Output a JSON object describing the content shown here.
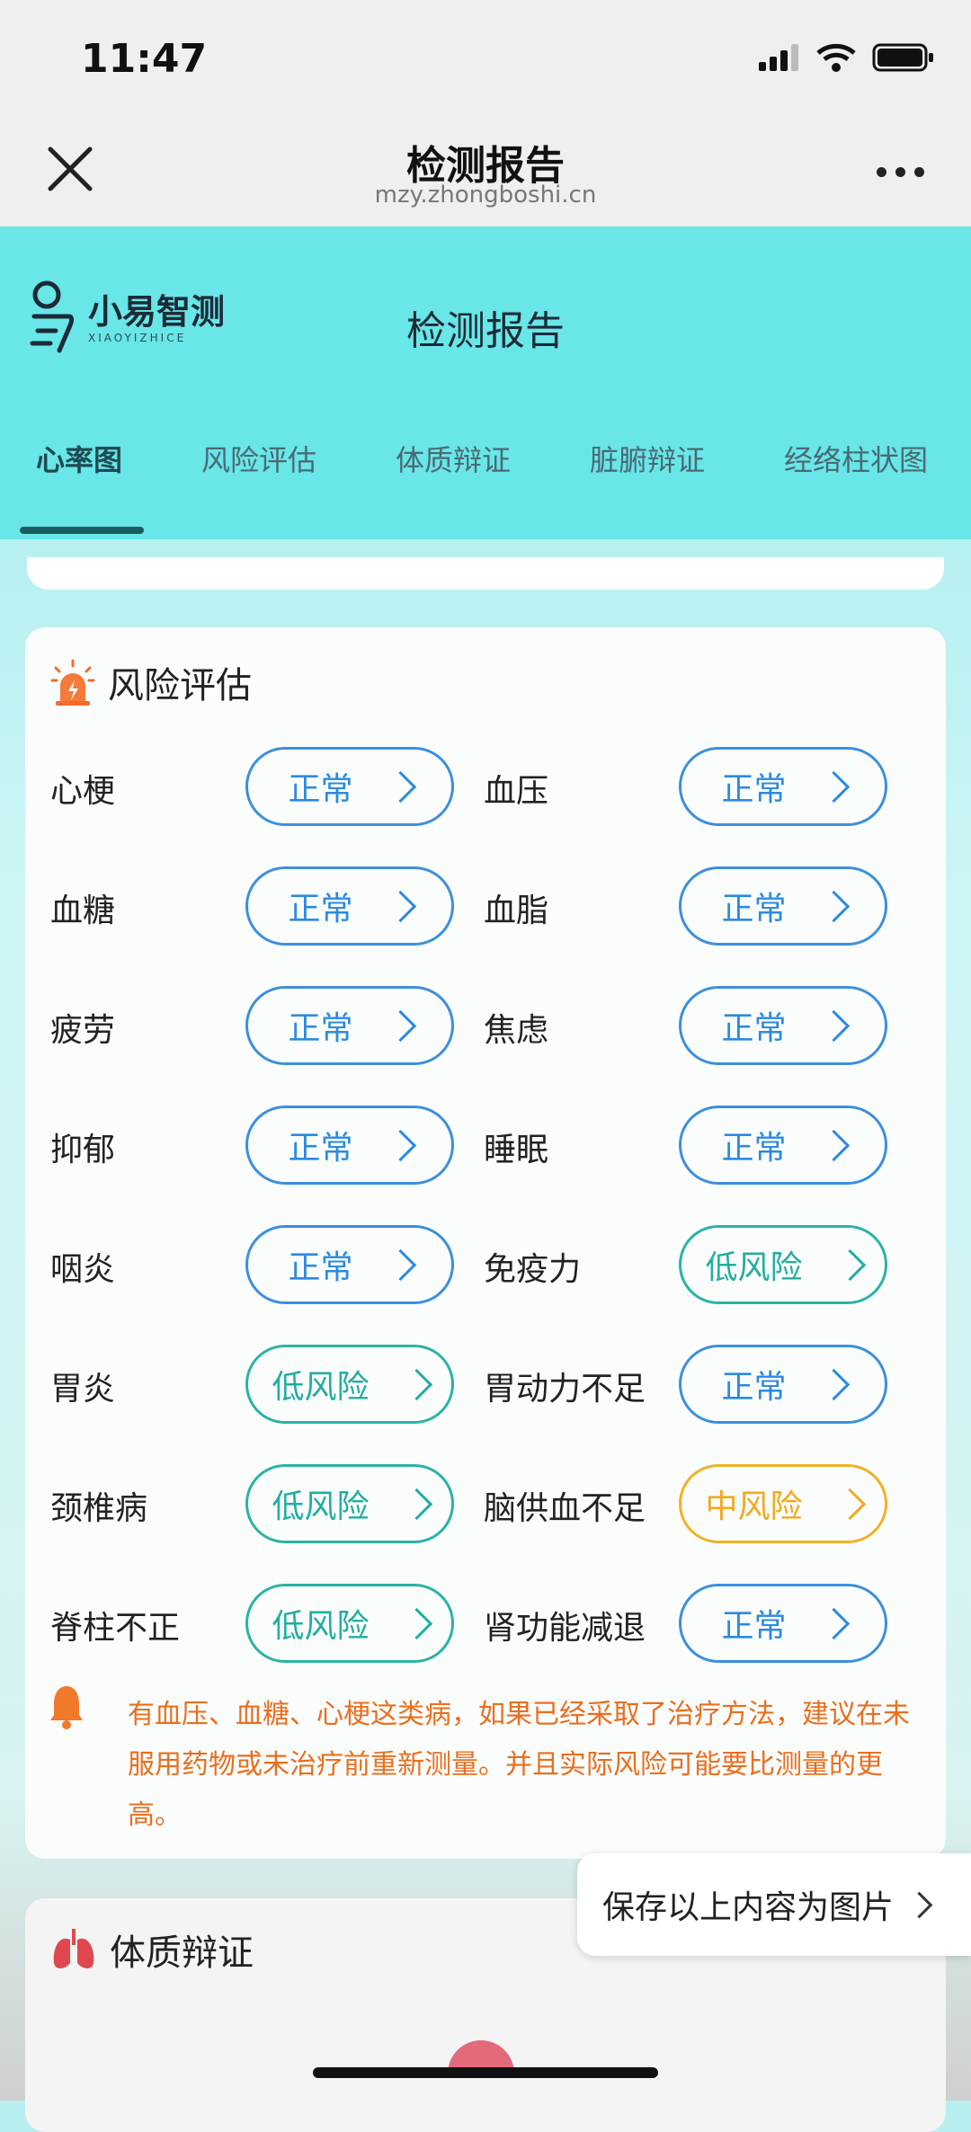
{
  "status_bar": {
    "time": "11:47"
  },
  "browser": {
    "title": "检测报告",
    "url": "mzy.zhongboshi.cn"
  },
  "app": {
    "logo_cn": "小易智测",
    "logo_en": "XIAOYIZHICE",
    "title": "检测报告",
    "tabs": [
      "心率图",
      "风险评估",
      "体质辩证",
      "脏腑辩证",
      "经络柱状图"
    ],
    "active_tab": "心率图"
  },
  "risk": {
    "title": "风险评估",
    "items": [
      {
        "label": "心梗",
        "status": "正常",
        "level": "normal"
      },
      {
        "label": "血压",
        "status": "正常",
        "level": "normal"
      },
      {
        "label": "血糖",
        "status": "正常",
        "level": "normal"
      },
      {
        "label": "血脂",
        "status": "正常",
        "level": "normal"
      },
      {
        "label": "疲劳",
        "status": "正常",
        "level": "normal"
      },
      {
        "label": "焦虑",
        "status": "正常",
        "level": "normal"
      },
      {
        "label": "抑郁",
        "status": "正常",
        "level": "normal"
      },
      {
        "label": "睡眠",
        "status": "正常",
        "level": "normal"
      },
      {
        "label": "咽炎",
        "status": "正常",
        "level": "normal"
      },
      {
        "label": "免疫力",
        "status": "低风险",
        "level": "low"
      },
      {
        "label": "胃炎",
        "status": "低风险",
        "level": "low"
      },
      {
        "label": "胃动力不足",
        "status": "正常",
        "level": "normal"
      },
      {
        "label": "颈椎病",
        "status": "低风险",
        "level": "low"
      },
      {
        "label": "脑供血不足",
        "status": "中风险",
        "level": "mid"
      },
      {
        "label": "脊柱不正",
        "status": "低风险",
        "level": "low"
      },
      {
        "label": "肾功能减退",
        "status": "正常",
        "level": "normal"
      }
    ],
    "notice": "有血压、血糖、心梗这类病，如果已经采取了治疗方法，建议在未服用药物或未治疗前重新测量。并且实际风险可能要比测量的更高。"
  },
  "save_button": "保存以上内容为图片",
  "constitution": {
    "title": "体质辩证"
  },
  "colors": {
    "normal": "#2c8ae0",
    "low": "#23ada0",
    "mid": "#f2a91f",
    "notice": "#ea6e1d",
    "header": "#68e6e8"
  }
}
